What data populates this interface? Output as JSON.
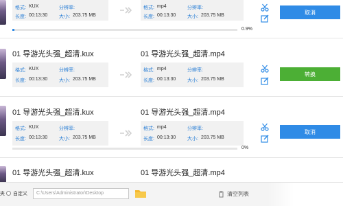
{
  "rows": [
    {
      "source": {
        "title": "",
        "format_label": "格式:",
        "format": "KUX",
        "resolution_label": "分辨率:",
        "resolution": "",
        "duration_label": "长度:",
        "duration": "00:13:30",
        "size_label": "大小:",
        "size": "203.75 MB"
      },
      "target": {
        "title": "",
        "format_label": "格式:",
        "format": "mp4",
        "resolution_label": "分辨率:",
        "resolution": "",
        "duration_label": "长度:",
        "duration": "00:13:30",
        "size_label": "大小:",
        "size": "203.75 MB"
      },
      "action": {
        "label": "取消",
        "style": "blue"
      },
      "progress": {
        "fraction": 0.009,
        "label": "0.9%"
      }
    },
    {
      "source": {
        "title": "01 导游光头强_超清.kux",
        "format_label": "格式:",
        "format": "KUX",
        "resolution_label": "分辨率:",
        "resolution": "",
        "duration_label": "长度:",
        "duration": "00:13:30",
        "size_label": "大小:",
        "size": "203.75 MB"
      },
      "target": {
        "title": "01 导游光头强_超清.mp4",
        "format_label": "格式:",
        "format": "mp4",
        "resolution_label": "分辨率:",
        "resolution": "",
        "duration_label": "长度:",
        "duration": "00:13:30",
        "size_label": "大小:",
        "size": "203.75 MB"
      },
      "action": {
        "label": "转换",
        "style": "green"
      },
      "progress": null
    },
    {
      "source": {
        "title": "01 导游光头强_超清.kux",
        "format_label": "格式:",
        "format": "KUX",
        "resolution_label": "分辨率:",
        "resolution": "",
        "duration_label": "长度:",
        "duration": "00:13:30",
        "size_label": "大小:",
        "size": "203.75 MB"
      },
      "target": {
        "title": "01 导游光头强_超清.mp4",
        "format_label": "格式:",
        "format": "mp4",
        "resolution_label": "分辨率:",
        "resolution": "",
        "duration_label": "长度:",
        "duration": "00:13:30",
        "size_label": "大小:",
        "size": "203.75 MB"
      },
      "action": {
        "label": "取消",
        "style": "blue"
      },
      "progress": {
        "fraction": 0.0,
        "label": "0%"
      }
    },
    {
      "source": {
        "title": "01 导游光头强_超清.kux"
      },
      "target": {
        "title": "01 导游光头强_超清.mp4"
      }
    }
  ],
  "bottom": {
    "output_label_cut": "夹",
    "custom_label": "自定义",
    "path": "C:\\Users\\Administrator\\Desktop",
    "clear_list": "清空列表"
  },
  "colors": {
    "accent": "#2f8be6",
    "convert": "#4caf35",
    "label_blue": "#2a7fd6"
  },
  "icons": [
    "scissors-icon",
    "edit-icon",
    "arrow-right-icon",
    "folder-icon",
    "trash-icon"
  ]
}
